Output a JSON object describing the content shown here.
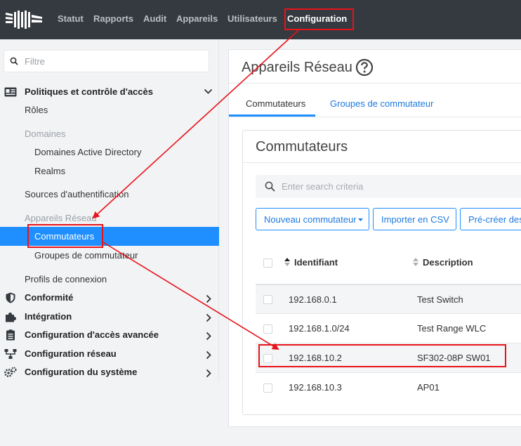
{
  "navbar": {
    "items": [
      {
        "label": "Statut"
      },
      {
        "label": "Rapports"
      },
      {
        "label": "Audit"
      },
      {
        "label": "Appareils"
      },
      {
        "label": "Utilisateurs"
      },
      {
        "label": "Configuration"
      }
    ],
    "active": "Configuration"
  },
  "sidebar": {
    "filter_placeholder": "Filtre",
    "sections": [
      {
        "label": "Politiques et contrôle d'accès",
        "icon": "id-card-icon",
        "expanded": true
      },
      {
        "label": "Conformité",
        "icon": "shield-icon"
      },
      {
        "label": "Intégration",
        "icon": "puzzle-icon"
      },
      {
        "label": "Configuration d'accès avancée",
        "icon": "clipboard-icon"
      },
      {
        "label": "Configuration réseau",
        "icon": "network-icon"
      },
      {
        "label": "Configuration du système",
        "icon": "gears-icon"
      }
    ],
    "items": {
      "roles": "Rôles",
      "domaines_header": "Domaines",
      "ad_domains": "Domaines Active Directory",
      "realms": "Realms",
      "auth_sources": "Sources d'authentification",
      "network_devices_header": "Appareils Réseau",
      "switches": "Commutateurs",
      "switch_groups": "Groupes de commutateur",
      "connection_profiles": "Profils de connexion"
    },
    "active_item": "Commutateurs"
  },
  "main": {
    "title": "Appareils Réseau",
    "tabs": [
      {
        "label": "Commutateurs",
        "active": true
      },
      {
        "label": "Groupes de commutateur",
        "active": false
      }
    ],
    "card": {
      "title": "Commutateurs",
      "search_placeholder": "Enter search criteria",
      "buttons": {
        "new": "Nouveau commutateur",
        "import": "Importer en CSV",
        "precreate": "Pré-créer des"
      },
      "columns": [
        "Identifiant",
        "Description"
      ],
      "rows": [
        {
          "id": "192.168.0.1",
          "description": "Test Switch"
        },
        {
          "id": "192.168.1.0/24",
          "description": "Test Range WLC"
        },
        {
          "id": "192.168.10.2",
          "description": "SF302-08P SW01"
        },
        {
          "id": "192.168.10.3",
          "description": "AP01"
        }
      ]
    }
  },
  "colors": {
    "navbar_bg": "#343a40",
    "accent": "#1f8fff",
    "annotation": "#e8131b"
  }
}
